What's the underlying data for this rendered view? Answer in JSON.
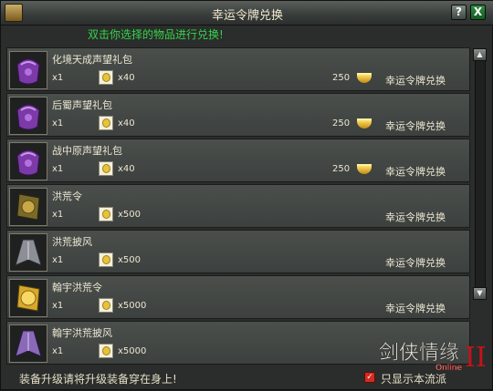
{
  "window": {
    "title": "幸运令牌兑换",
    "help_label": "?",
    "close_label": "X"
  },
  "hint": "双击你选择的物品进行兑换!",
  "items": [
    {
      "name": "化境天成声望礼包",
      "qty": "x1",
      "cost": "x40",
      "gold": "250",
      "exchange": "幸运令牌兑换",
      "icon": "purple-bag-icon"
    },
    {
      "name": "后蜀声望礼包",
      "qty": "x1",
      "cost": "x40",
      "gold": "250",
      "exchange": "幸运令牌兑换",
      "icon": "purple-bag-icon"
    },
    {
      "name": "战中原声望礼包",
      "qty": "x1",
      "cost": "x40",
      "gold": "250",
      "exchange": "幸运令牌兑换",
      "icon": "purple-bag-icon"
    },
    {
      "name": "洪荒令",
      "qty": "x1",
      "cost": "x500",
      "gold": "",
      "exchange": "幸运令牌兑换",
      "icon": "bronze-token-icon"
    },
    {
      "name": "洪荒披风",
      "qty": "x1",
      "cost": "x500",
      "gold": "",
      "exchange": "幸运令牌兑换",
      "icon": "grey-cape-icon"
    },
    {
      "name": "翰宇洪荒令",
      "qty": "x1",
      "cost": "x5000",
      "gold": "",
      "exchange": "幸运令牌兑换",
      "icon": "gold-token-icon"
    },
    {
      "name": "翰宇洪荒披风",
      "qty": "x1",
      "cost": "x5000",
      "gold": "",
      "exchange": "",
      "icon": "purple-cape-icon"
    }
  ],
  "footer": {
    "tip": "装备升级请将升级装备穿在身上!",
    "checkbox_label": "只显示本流派"
  },
  "logo": {
    "text": "剑侠情缘",
    "sub": "Online",
    "numeral": "II"
  },
  "colors": {
    "hint_green": "#36d34a",
    "checkbox_red": "#d42a20",
    "gold": "#e6c43a"
  }
}
